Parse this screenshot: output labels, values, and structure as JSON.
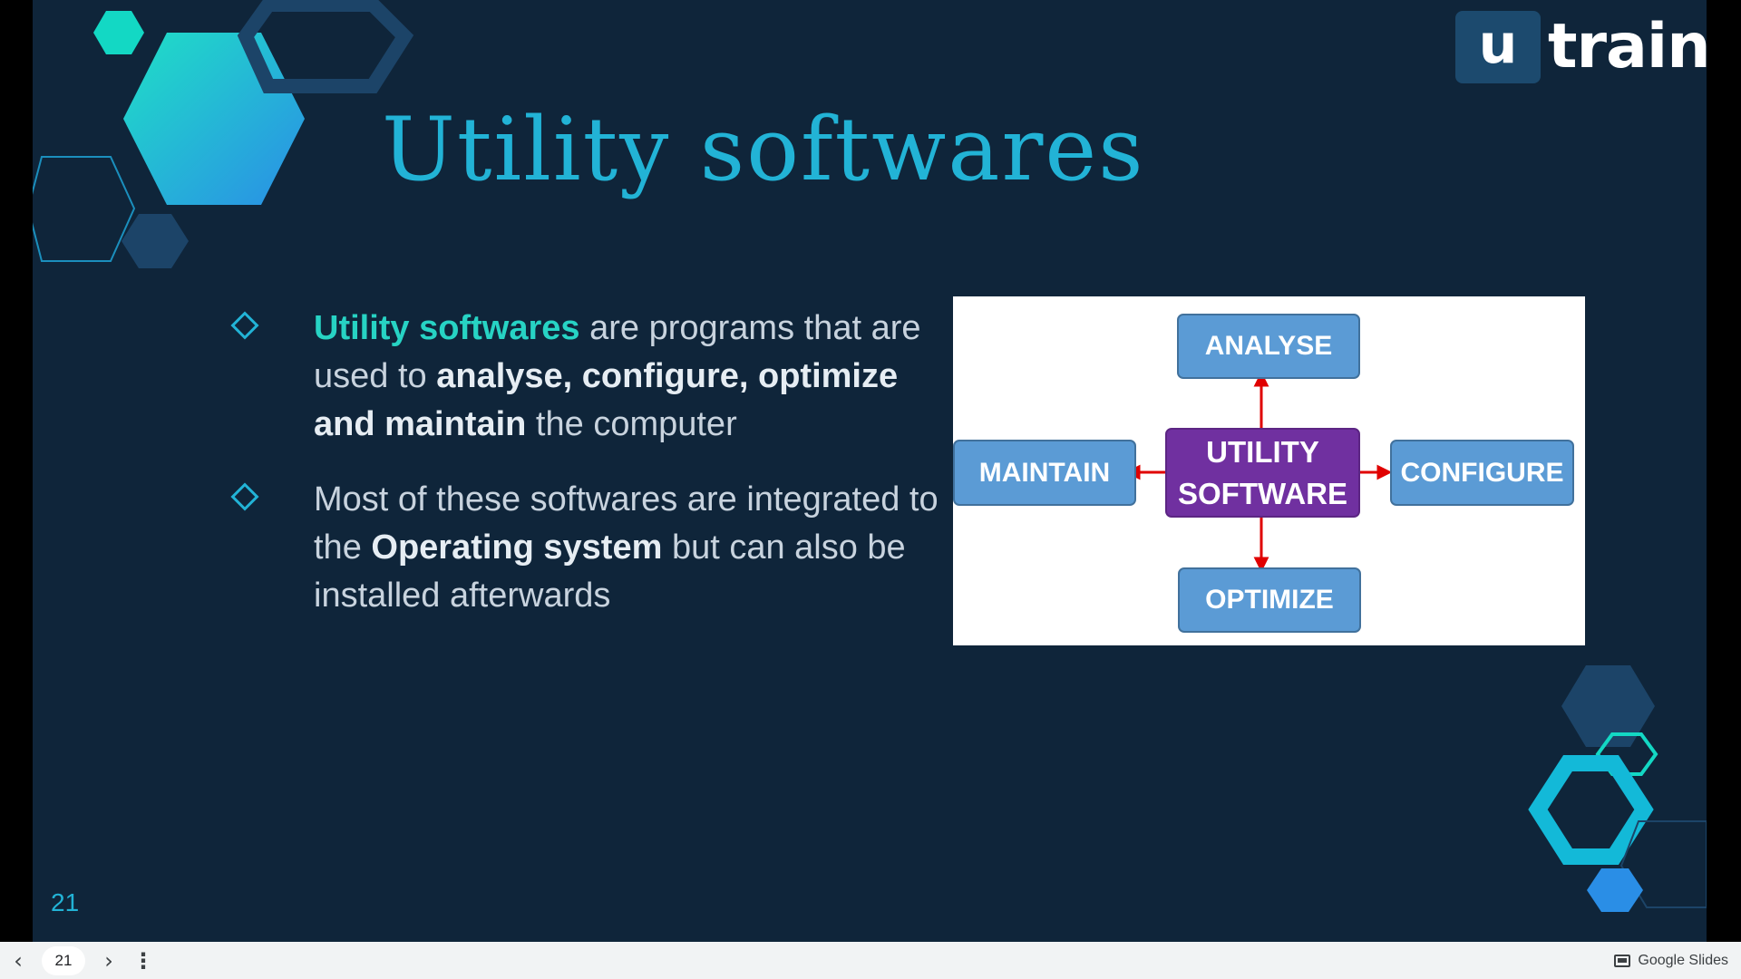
{
  "slide": {
    "title": "Utility softwares",
    "page_number": "21",
    "logo": {
      "letter": "u",
      "word": "train"
    },
    "bullets": [
      {
        "lead": "Utility softwares",
        "text1": " are programs that are used to ",
        "bold1": "analyse, configure, optimize and maintain",
        "text2": " the computer"
      },
      {
        "text1": "Most of these softwares are integrated to the ",
        "bold1": "Operating system",
        "text2": " but can also be installed afterwards"
      }
    ],
    "diagram": {
      "center_line1": "UTILITY",
      "center_line2": "SOFTWARE",
      "top": "ANALYSE",
      "right": "CONFIGURE",
      "bottom": "OPTIMIZE",
      "left": "MAINTAIN"
    }
  },
  "colors": {
    "background": "#0f253a",
    "accent_cyan": "#22b3d6",
    "accent_teal": "#27d3c4",
    "box_blue": "#5b9bd5",
    "box_purple": "#7030a0",
    "arrow_red": "#e00000"
  },
  "toolbar": {
    "prev_icon": "chevron-left-icon",
    "next_icon": "chevron-right-icon",
    "current_page": "21",
    "menu_icon": "more-vertical-icon",
    "brand_label": "Google Slides"
  }
}
